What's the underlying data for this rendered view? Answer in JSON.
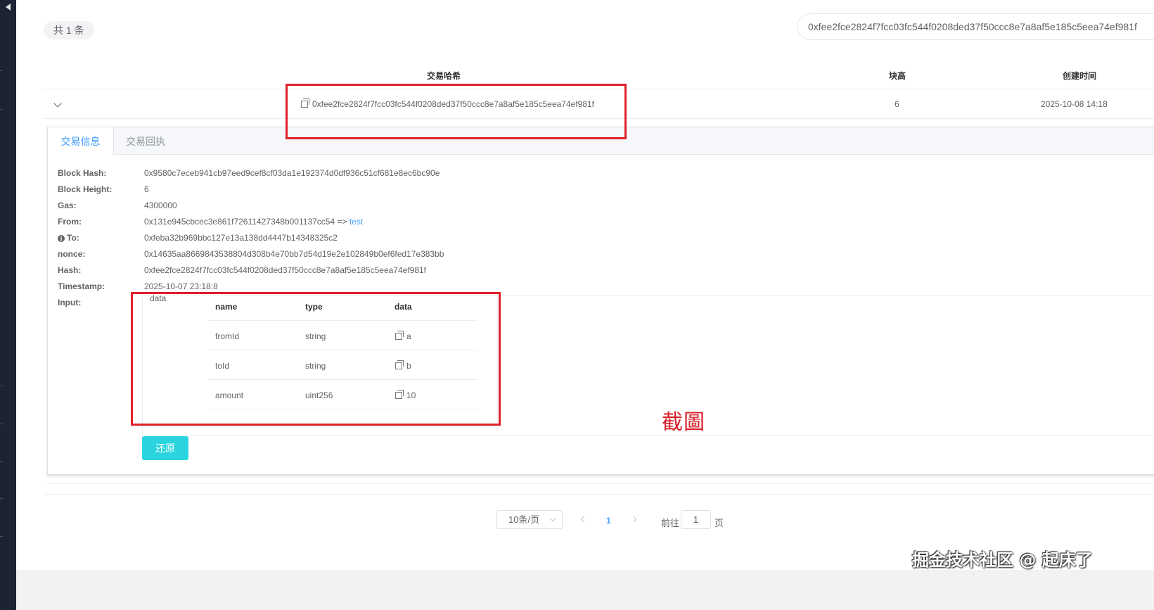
{
  "toolbar": {
    "total_count": "共 1 条",
    "search_value": "0xfee2fce2824f7fcc03fc544f0208ded37f50ccc8e7a8af5e185c5eea74ef981f"
  },
  "table": {
    "headers": [
      "交易哈希",
      "块高",
      "创建时间"
    ],
    "row": {
      "hash": "0xfee2fce2824f7fcc03fc544f0208ded37f50ccc8e7a8af5e185c5eea74ef981f",
      "block": "6",
      "created": "2025-10-08 14:18"
    }
  },
  "detail": {
    "tabs": [
      "交易信息",
      "交易回执"
    ],
    "active_tab": 0,
    "fields": {
      "block_hash_label": "Block Hash:",
      "block_hash": "0x9580c7eceb941cb97eed9cef8cf03da1e192374d0df936c51cf681e8ec6bc90e",
      "block_height_label": "Block Height:",
      "block_height": "6",
      "gas_label": "Gas:",
      "gas": "4300000",
      "from_label": "From:",
      "from": "0x131e945cbcec3e861f72611427348b001137cc54 =>",
      "from_link": "test",
      "to_label": "To:",
      "to": "0xfeba32b969bbc127e13a138dd4447b14348325c2",
      "nonce_label": "nonce:",
      "nonce": "0x14635aa8669843538804d308b4e70bb7d54d19e2e102849b0ef6fed17e383bb",
      "hash_label": "Hash:",
      "hash": "0xfee2fce2824f7fcc03fc544f0208ded37f50ccc8e7a8af5e185c5eea74ef981f",
      "timestamp_label": "Timestamp:",
      "timestamp": "2025-10-07 23:18:8",
      "input_label": "Input:"
    },
    "input": {
      "caption": "data",
      "headers": [
        "name",
        "type",
        "data"
      ],
      "rows": [
        {
          "name": "fromId",
          "type": "string",
          "data": "a"
        },
        {
          "name": "toId",
          "type": "string",
          "data": "b"
        },
        {
          "name": "amount",
          "type": "uint256",
          "data": "10"
        }
      ]
    },
    "restore_button": "还原"
  },
  "annotation": "截圖",
  "pagination": {
    "page_size": "10条/页",
    "current_page": "1",
    "goto_label": "前往",
    "goto_value": "1",
    "page_suffix": "页"
  },
  "watermark": "掘金技术社区 @ 起床了",
  "colors": {
    "accent": "#409eff",
    "restore_button": "#2ad4de",
    "annotation_red": "#e0202a",
    "sidebar": "#1c2333"
  }
}
